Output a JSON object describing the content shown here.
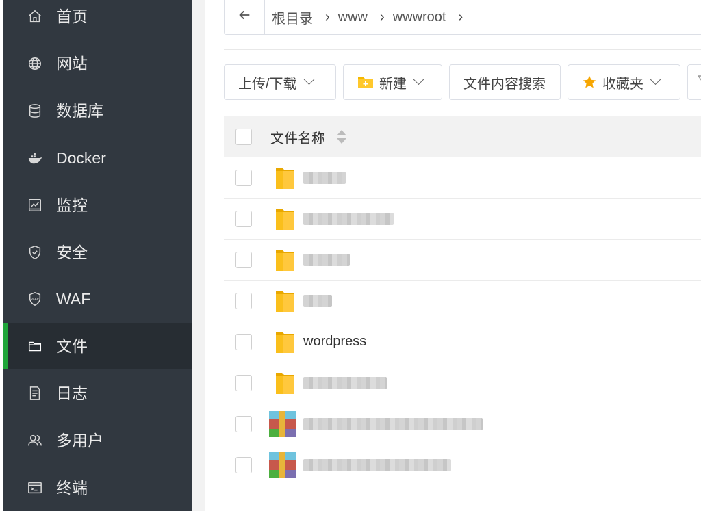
{
  "sidebar": {
    "items": [
      {
        "label": "首页",
        "icon": "home-icon",
        "active": false
      },
      {
        "label": "网站",
        "icon": "globe-icon",
        "active": false
      },
      {
        "label": "数据库",
        "icon": "database-icon",
        "active": false
      },
      {
        "label": "Docker",
        "icon": "docker-icon",
        "active": false
      },
      {
        "label": "监控",
        "icon": "monitor-chart-icon",
        "active": false
      },
      {
        "label": "安全",
        "icon": "shield-check-icon",
        "active": false
      },
      {
        "label": "WAF",
        "icon": "waf-shield-icon",
        "active": false
      },
      {
        "label": "文件",
        "icon": "folder-icon",
        "active": true
      },
      {
        "label": "日志",
        "icon": "log-document-icon",
        "active": false
      },
      {
        "label": "多用户",
        "icon": "users-icon",
        "active": false
      },
      {
        "label": "终端",
        "icon": "terminal-icon",
        "active": false
      }
    ],
    "active_color": "#20a53a"
  },
  "pathbar": {
    "back_icon": "arrow-left-icon",
    "crumbs": [
      "根目录",
      "www",
      "wwwroot"
    ]
  },
  "toolbar": {
    "upload_label": "上传/下载",
    "new_label": "新建",
    "search_label": "文件内容搜索",
    "favorites_label": "收藏夹"
  },
  "table": {
    "header_name": "文件名称",
    "rows": [
      {
        "name": "",
        "type": "folder",
        "redacted": true
      },
      {
        "name": "",
        "type": "folder",
        "redacted": true
      },
      {
        "name": "",
        "type": "folder",
        "redacted": true
      },
      {
        "name": "",
        "type": "folder",
        "redacted": true
      },
      {
        "name": "wordpress",
        "type": "folder",
        "redacted": false
      },
      {
        "name": "",
        "type": "folder",
        "redacted": true
      },
      {
        "name": "",
        "type": "archive",
        "redacted": true
      },
      {
        "name": "",
        "type": "archive",
        "redacted": true
      }
    ]
  }
}
